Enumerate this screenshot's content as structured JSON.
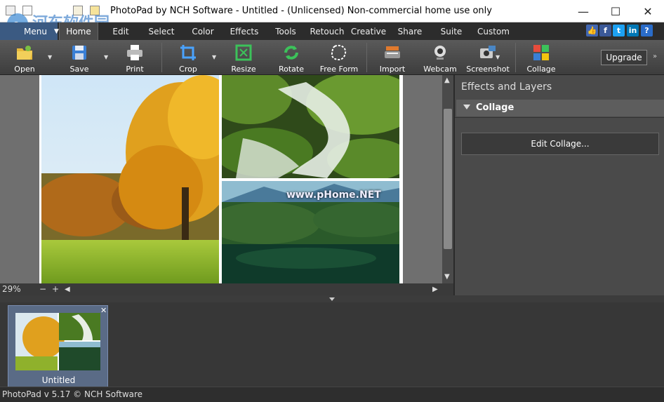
{
  "window": {
    "title": "PhotoPad by NCH Software - Untitled - (Unlicensed) Non-commercial home use only",
    "minimize": "—",
    "maximize": "☐",
    "close": "✕"
  },
  "menu": {
    "menu_button": "Menu",
    "tabs": [
      "Home",
      "Edit",
      "Select",
      "Color",
      "Effects",
      "Tools",
      "Retouch",
      "Creative",
      "Share",
      "Suite",
      "Custom"
    ],
    "active_tab": "Home",
    "social": [
      {
        "icon": "like-icon",
        "glyph": "👍",
        "color": "#4267b2"
      },
      {
        "icon": "facebook-icon",
        "glyph": "f",
        "color": "#3b5998"
      },
      {
        "icon": "twitter-icon",
        "glyph": "t",
        "color": "#1da1f2"
      },
      {
        "icon": "linkedin-icon",
        "glyph": "in",
        "color": "#0077b5"
      },
      {
        "icon": "help-icon",
        "glyph": "?",
        "color": "#2a6cc9"
      }
    ]
  },
  "toolbar": {
    "open": "Open",
    "save": "Save",
    "print": "Print",
    "crop": "Crop",
    "resize": "Resize",
    "rotate": "Rotate",
    "free_form": "Free Form",
    "import": "Import",
    "webcam": "Webcam",
    "screenshot": "Screenshot",
    "collage": "Collage",
    "upgrade": "Upgrade",
    "more": "»"
  },
  "canvas": {
    "watermark_text": "www.pHome.NET",
    "zoom": "29%",
    "zoom_out": "−",
    "zoom_in": "+"
  },
  "panel": {
    "header": "Effects and Layers",
    "section": "Collage",
    "edit_button": "Edit Collage..."
  },
  "tray": {
    "items": [
      {
        "caption": "Untitled"
      }
    ]
  },
  "status": {
    "text": "PhotoPad v 5.17 © NCH Software"
  },
  "site_watermark": {
    "text": "河东软件园",
    "url": "www.pc0359.cn"
  }
}
